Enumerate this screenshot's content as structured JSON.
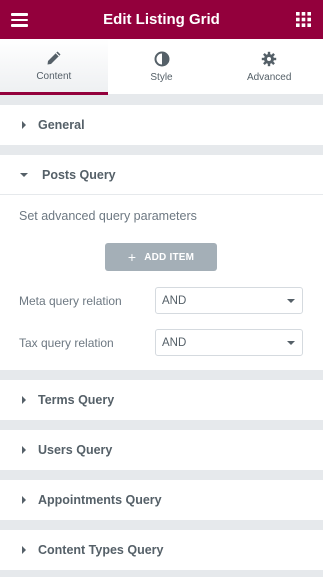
{
  "header": {
    "title": "Edit Listing Grid",
    "menu_icon": "hamburger-icon",
    "grid_icon": "apps-grid-icon",
    "bg_color": "#93003c"
  },
  "tabs": [
    {
      "label": "Content",
      "icon": "pencil-icon",
      "active": true
    },
    {
      "label": "Style",
      "icon": "half-circle-icon",
      "active": false
    },
    {
      "label": "Advanced",
      "icon": "gear-icon",
      "active": false
    }
  ],
  "sections": {
    "general": {
      "label": "General",
      "expanded": false
    },
    "posts_query": {
      "label": "Posts Query",
      "expanded": true,
      "description": "Set advanced query parameters",
      "add_item_label": "ADD ITEM",
      "meta_relation": {
        "label": "Meta query relation",
        "value": "AND"
      },
      "tax_relation": {
        "label": "Tax query relation",
        "value": "AND"
      }
    },
    "terms_query": {
      "label": "Terms Query",
      "expanded": false
    },
    "users_query": {
      "label": "Users Query",
      "expanded": false
    },
    "appointments_query": {
      "label": "Appointments Query",
      "expanded": false
    },
    "content_types_query": {
      "label": "Content Types Query",
      "expanded": false
    }
  }
}
